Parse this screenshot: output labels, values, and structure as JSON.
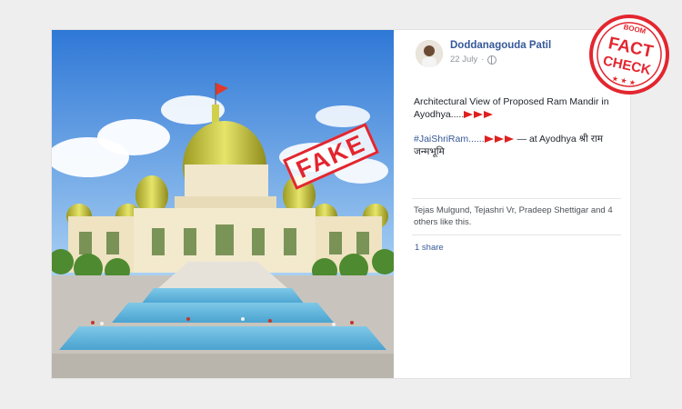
{
  "post": {
    "author": "Doddanagouda Patil",
    "date": "22 July",
    "line1": "Architectural View of Proposed Ram Mandir in Ayodhya.....",
    "hashtag": "#JaiShriRam......",
    "location": " — at Ayodhya श्री राम जन्मभूमि",
    "likes": "Tejas Mulgund, Tejashri Vr, Pradeep Shettigar and 4 others like this.",
    "shares": "1 share"
  },
  "stamps": {
    "fake_label": "FAKE",
    "badge_top": "BOOM",
    "badge_line1": "FACT",
    "badge_line2": "CHECK"
  },
  "icons": {
    "globe": "globe-icon",
    "flag": "red-flag-icon"
  },
  "colors": {
    "link": "#365899",
    "stamp_red": "#e3262f"
  }
}
